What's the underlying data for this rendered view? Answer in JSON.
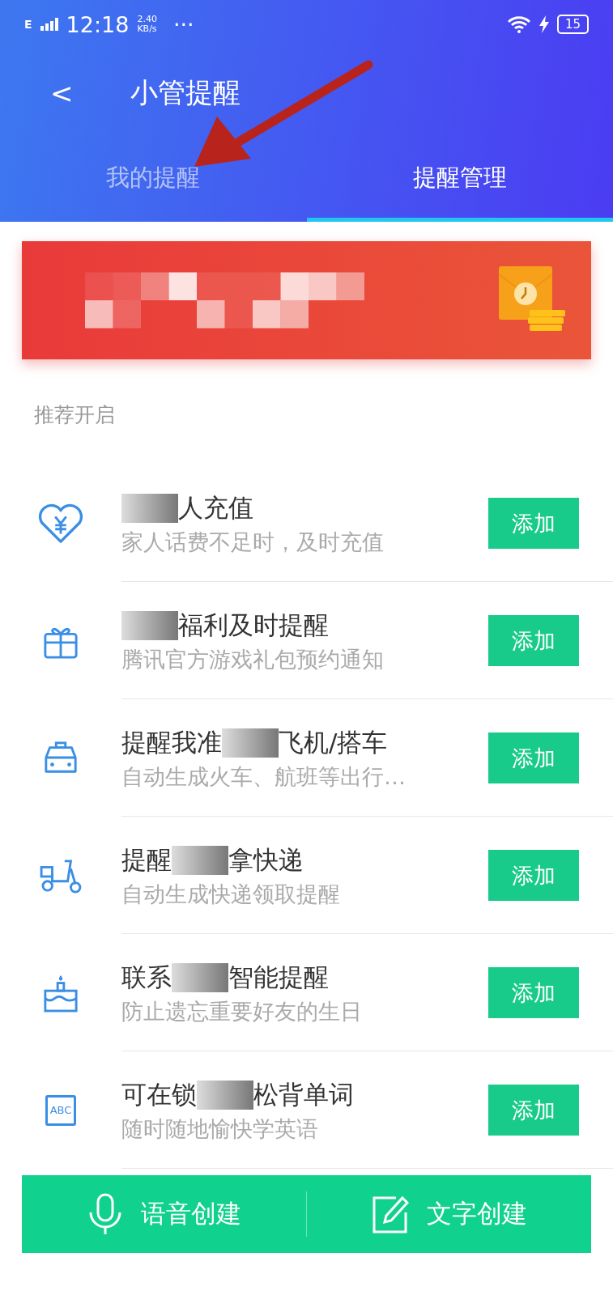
{
  "status_bar": {
    "network": "E",
    "time": "12:18",
    "speed": "2.40",
    "speed_unit": "KB/s",
    "more": "···",
    "battery": "15"
  },
  "header": {
    "back": "<",
    "title": "小管提醒"
  },
  "tabs": [
    {
      "label": "我的提醒",
      "selected": false
    },
    {
      "label": "提醒管理",
      "selected": true
    }
  ],
  "section_title": "推荐开启",
  "items": [
    {
      "kind": "heart",
      "title_after": "人充值",
      "subtitle": "家人话费不足时，及时充值",
      "button": "添加"
    },
    {
      "kind": "gift",
      "title_after": "福利及时提醒",
      "subtitle": "腾讯官方游戏礼包预约通知",
      "button": "添加"
    },
    {
      "kind": "car",
      "title_before": "提醒我准",
      "title_after": "飞机/搭车",
      "subtitle": "自动生成火车、航班等出行…",
      "button": "添加"
    },
    {
      "kind": "scooter",
      "title_before": "提醒",
      "title_after": "拿快递",
      "subtitle": "自动生成快递领取提醒",
      "button": "添加"
    },
    {
      "kind": "cake",
      "title_before": "联系",
      "title_after": "智能提醒",
      "subtitle": "防止遗忘重要好友的生日",
      "button": "添加"
    },
    {
      "kind": "abc",
      "icon_text": "ABC",
      "title_before": "可在锁",
      "title_after": "松背单词",
      "subtitle": "随时随地愉快学英语",
      "button": "添加"
    }
  ],
  "bottom_actions": [
    {
      "kind": "mic",
      "label": "语音创建"
    },
    {
      "kind": "edit",
      "label": "文字创建"
    }
  ]
}
